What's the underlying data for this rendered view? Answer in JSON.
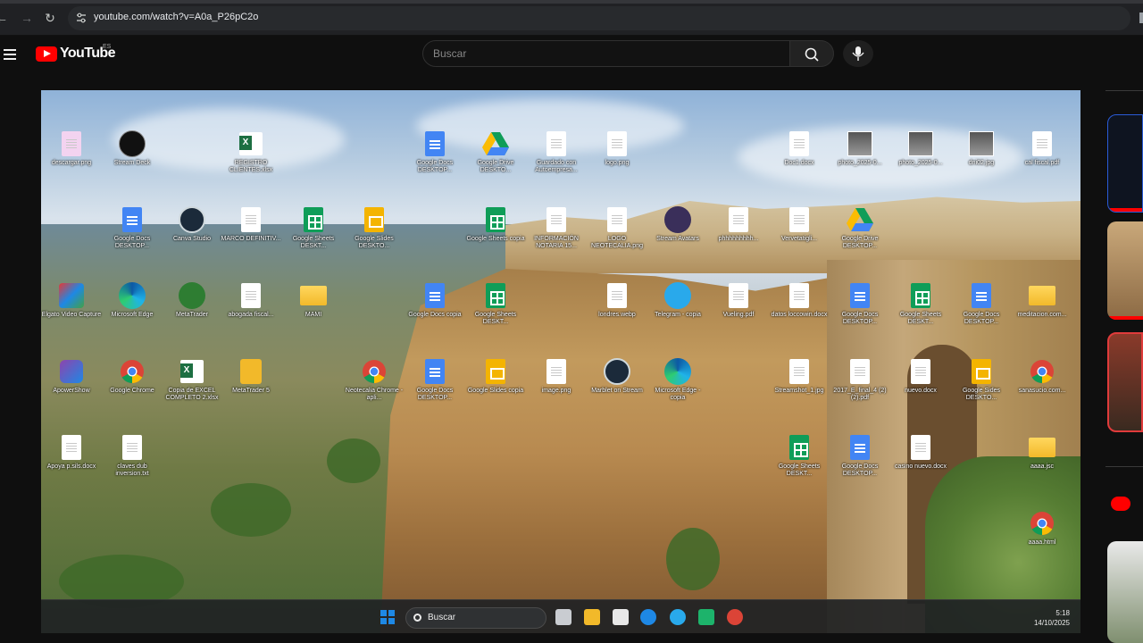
{
  "browser": {
    "url": "youtube.com/watch?v=A0a_P26pC2o"
  },
  "youtube": {
    "logo_text": "YouTube",
    "country_code": "ES",
    "search_placeholder": "Buscar"
  },
  "desktop": {
    "icons": [
      {
        "label": "descargar.png",
        "kind": "ss"
      },
      {
        "label": "Stream Deck",
        "kind": "streamdeck"
      },
      {
        "label": "REGISTRO CLIENTES.xlsx",
        "kind": "excel"
      },
      {
        "label": "Google Docs DESKTOP...",
        "kind": "gdoc"
      },
      {
        "label": "Google Drive DESKTO...",
        "kind": "gdrive"
      },
      {
        "label": "Guardado con Autoempresa...",
        "kind": "doc"
      },
      {
        "label": "logo.png",
        "kind": "doc"
      },
      {
        "label": "Doc1.docx",
        "kind": "doc"
      },
      {
        "label": "photo_2025-0...",
        "kind": "photo"
      },
      {
        "label": "photo_2025-0...",
        "kind": "photo"
      },
      {
        "label": "dni02.jpg",
        "kind": "photo"
      },
      {
        "label": "cal fiscal.pdf",
        "kind": "doc"
      },
      {
        "label": "Google Docs DESKTOP...",
        "kind": "gdoc"
      },
      {
        "label": "Canva Studio",
        "kind": "round"
      },
      {
        "label": "MARCO DEFINITIV...",
        "kind": "doc"
      },
      {
        "label": "Google Sheets DESKT...",
        "kind": "gsheet"
      },
      {
        "label": "Google Slides DESKTO...",
        "kind": "gslide"
      },
      {
        "label": "Google Sheets copia",
        "kind": "gsheet"
      },
      {
        "label": "INFORMACIÓN NOTARIA 15...",
        "kind": "doc"
      },
      {
        "label": "LOGO NEOTECALIA.png",
        "kind": "doc"
      },
      {
        "label": "Stream Avatars",
        "kind": "sa"
      },
      {
        "label": "phhhhhhhhh...",
        "kind": "doc"
      },
      {
        "label": "Vervetatigli...",
        "kind": "doc"
      },
      {
        "label": "Google Drive DESKTOP...",
        "kind": "gdrive"
      },
      {
        "label": "Elgato Video Capture",
        "kind": "elgato"
      },
      {
        "label": "Microsoft Edge",
        "kind": "edge"
      },
      {
        "label": "MetaTrader",
        "kind": "mt"
      },
      {
        "label": "abogada fiscal...",
        "kind": "doc"
      },
      {
        "label": "MAMI",
        "kind": "folder"
      },
      {
        "label": "Google Docs copia",
        "kind": "gdoc"
      },
      {
        "label": "Google Sheets DESKT...",
        "kind": "gsheet"
      },
      {
        "label": "londres.webp",
        "kind": "doc"
      },
      {
        "label": "Telegram - copia",
        "kind": "telegram"
      },
      {
        "label": "Vueling.pdf",
        "kind": "doc"
      },
      {
        "label": "datos loccowin.docx",
        "kind": "doc"
      },
      {
        "label": "Google Docs DESKTOP...",
        "kind": "gdoc"
      },
      {
        "label": "Google Sheets DESKT...",
        "kind": "gsheet"
      },
      {
        "label": "Google Docs DESKTOP...",
        "kind": "gdoc"
      },
      {
        "label": "meditacion.com...",
        "kind": "folder"
      },
      {
        "label": "ApowerShow",
        "kind": "apower"
      },
      {
        "label": "Google Chrome",
        "kind": "chrome"
      },
      {
        "label": "Copia de EXCEL COMPLETO 2.xlsx",
        "kind": "excel"
      },
      {
        "label": "MetaTrader 5",
        "kind": "mt5"
      },
      {
        "label": "Neotecalia Chrome - apli...",
        "kind": "chrome"
      },
      {
        "label": "Google Docs DESKTOP...",
        "kind": "gdoc"
      },
      {
        "label": "Google Slides copia",
        "kind": "gslide"
      },
      {
        "label": "image.png",
        "kind": "doc"
      },
      {
        "label": "Marblet on Stream",
        "kind": "round"
      },
      {
        "label": "Microsoft Edge - copia",
        "kind": "edge"
      },
      {
        "label": "Streamshot_1.jpg",
        "kind": "doc"
      },
      {
        "label": "2017_E_final_4 (2) (2).pdf",
        "kind": "doc"
      },
      {
        "label": "nuevo.docx",
        "kind": "doc"
      },
      {
        "label": "Google Sides DESKTO...",
        "kind": "gslide"
      },
      {
        "label": "sanasucio.com...",
        "kind": "chrome"
      },
      {
        "label": "Apoya p.sils.docx",
        "kind": "doc"
      },
      {
        "label": "claves dub inversion.txt",
        "kind": "doc"
      },
      {
        "label": "Google Sheets DESKT...",
        "kind": "gsheet"
      },
      {
        "label": "Google Docs DESKTOP...",
        "kind": "gdoc"
      },
      {
        "label": "casino nuevo.docx",
        "kind": "doc"
      },
      {
        "label": "aaaa.jsc",
        "kind": "folder"
      },
      {
        "label": "aaaa.html",
        "kind": "chrome"
      }
    ]
  },
  "taskbar": {
    "search_label": "Buscar",
    "time": "5:18",
    "date": "14/10/2025"
  }
}
